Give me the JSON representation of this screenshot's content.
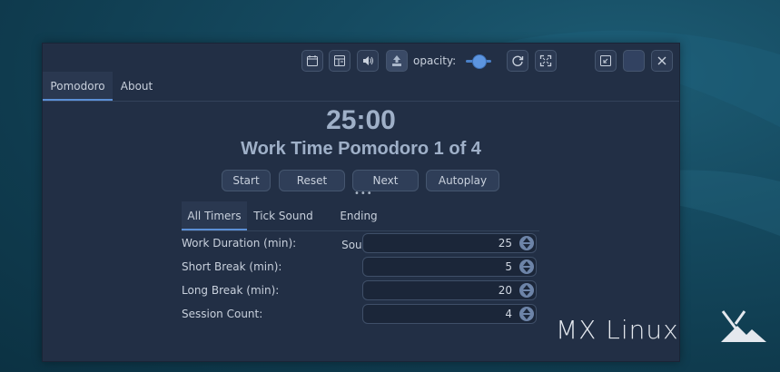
{
  "titlebar": {
    "opacity_label": "opacity:",
    "opacity_value": 0.5,
    "icons": [
      "calendar-icon",
      "layout-icon",
      "speaker-icon",
      "pin-top-icon",
      "refresh-icon",
      "fullscreen-icon",
      "restore-icon",
      "minimize-icon",
      "close-icon"
    ]
  },
  "tabs": {
    "pomodoro": "Pomodoro",
    "about": "About"
  },
  "timer": {
    "time": "25:00",
    "status": "Work Time Pomodoro 1 of 4"
  },
  "buttons": {
    "start": "Start",
    "reset": "Reset",
    "next": "Next",
    "autoplay": "Autoplay"
  },
  "subtabs": {
    "all_timers": "All Timers",
    "tick_sound": "Tick Sound",
    "ending_sound": "Ending Sound"
  },
  "settings": [
    {
      "label": "Work Duration (min):",
      "value": "25"
    },
    {
      "label": "Short Break (min):",
      "value": "5"
    },
    {
      "label": "Long Break (min):",
      "value": "20"
    },
    {
      "label": "Session Count:",
      "value": "4"
    }
  ],
  "desktop": {
    "logo_text": "MX Linux"
  },
  "colors": {
    "accent": "#5b8fd6",
    "window_bg": "#222f45",
    "timer_text": "#9fb0c8"
  }
}
